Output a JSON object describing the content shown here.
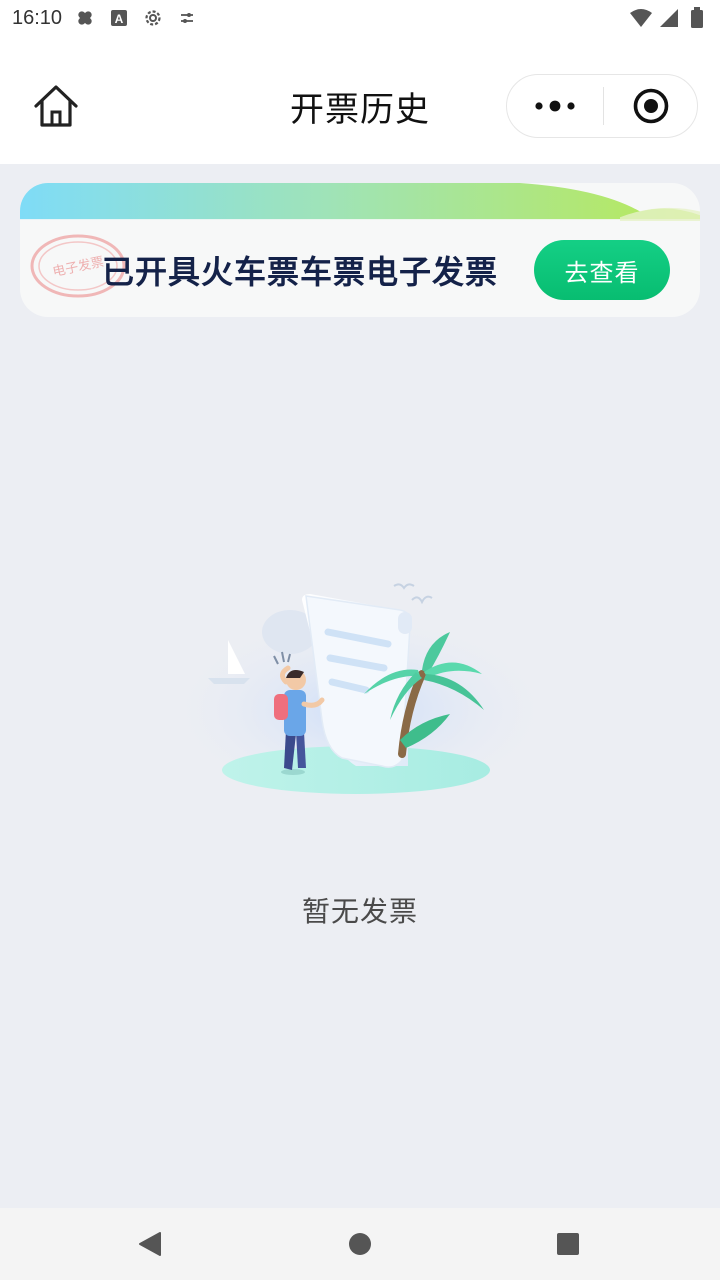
{
  "status_bar": {
    "time": "16:10",
    "icons_left": [
      "bandage-icon",
      "font-a-icon",
      "gear-icon",
      "tune-icon"
    ],
    "icons_right": [
      "wifi-icon",
      "signal-icon",
      "battery-icon"
    ]
  },
  "nav": {
    "title": "开票历史",
    "home_icon": "home-icon",
    "more_icon": "more-dots-icon",
    "close_icon": "target-close-icon"
  },
  "banner": {
    "text": "已开具火车票车票电子发票",
    "stamp_text": "电子发票",
    "button_label": "去查看",
    "colors": {
      "strip_start": "#7fdcf7",
      "strip_end": "#b9e957",
      "button": "#0fc67b",
      "text": "#142249"
    }
  },
  "empty_state": {
    "illustration": "empty-invoice-illustration",
    "text": "暂无发票"
  },
  "system_nav": {
    "back_icon": "back-triangle-icon",
    "home_icon": "home-circle-icon",
    "recent_icon": "recent-square-icon"
  }
}
